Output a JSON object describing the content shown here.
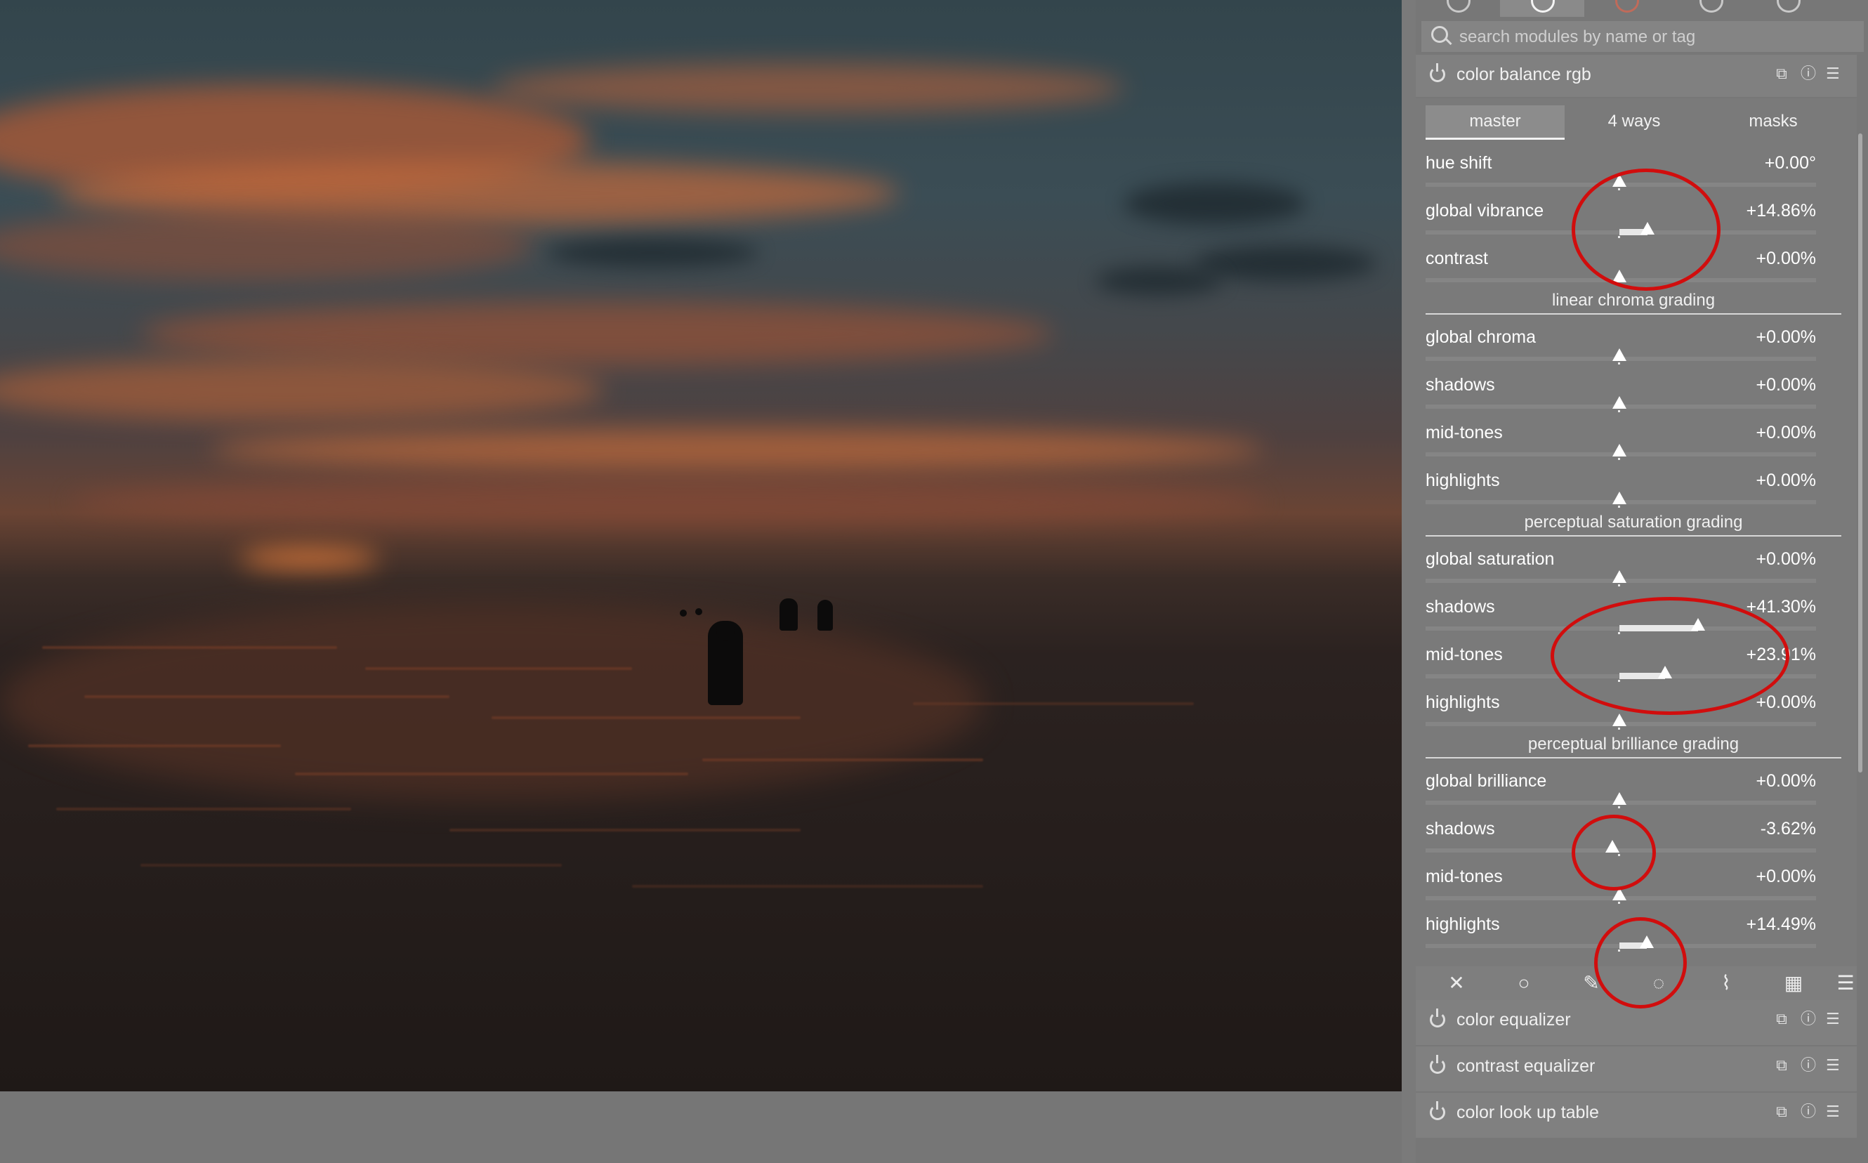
{
  "search": {
    "placeholder": "search modules by name or tag"
  },
  "module": {
    "name": "color balance rgb",
    "tabs": [
      "master",
      "4 ways",
      "masks"
    ],
    "active_tab": "master"
  },
  "top_rows": [
    {
      "label": "hue shift",
      "value": "+0.00°",
      "level": 0
    },
    {
      "label": "global vibrance",
      "value": "+14.86%",
      "level": 0.149
    },
    {
      "label": "contrast",
      "value": "+0.00%",
      "level": 0
    }
  ],
  "sections": [
    {
      "title": "linear chroma grading",
      "rows": [
        {
          "label": "global chroma",
          "value": "+0.00%",
          "level": 0
        },
        {
          "label": "shadows",
          "value": "+0.00%",
          "level": 0
        },
        {
          "label": "mid-tones",
          "value": "+0.00%",
          "level": 0
        },
        {
          "label": "highlights",
          "value": "+0.00%",
          "level": 0
        }
      ]
    },
    {
      "title": "perceptual saturation grading",
      "rows": [
        {
          "label": "global saturation",
          "value": "+0.00%",
          "level": 0
        },
        {
          "label": "shadows",
          "value": "+41.30%",
          "level": 0.413
        },
        {
          "label": "mid-tones",
          "value": "+23.91%",
          "level": 0.239
        },
        {
          "label": "highlights",
          "value": "+0.00%",
          "level": 0
        }
      ]
    },
    {
      "title": "perceptual brilliance grading",
      "rows": [
        {
          "label": "global brilliance",
          "value": "+0.00%",
          "level": 0
        },
        {
          "label": "shadows",
          "value": "-3.62%",
          "level": -0.036
        },
        {
          "label": "mid-tones",
          "value": "+0.00%",
          "level": 0
        },
        {
          "label": "highlights",
          "value": "+14.49%",
          "level": 0.145
        }
      ]
    }
  ],
  "other_modules": [
    "color equalizer",
    "contrast equalizer",
    "color look up table"
  ],
  "colors": {
    "annotation": "#d10d0d",
    "panel": "#777777"
  }
}
